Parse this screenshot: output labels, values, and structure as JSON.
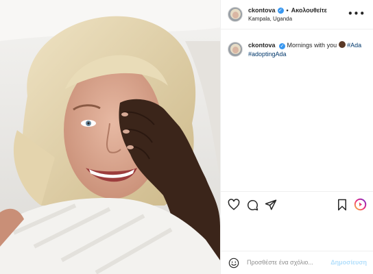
{
  "post": {
    "username": "ckontova",
    "verified_mark": "✓",
    "separator": "•",
    "follow_label": "Ακολουθείτε",
    "location": "Kampala, Uganda",
    "more_label": "•••"
  },
  "caption": {
    "username": "ckontova",
    "text": "Mornings with you",
    "emoji": "girl-emoji",
    "hashtags": [
      "#Ada",
      "#adoptingAda"
    ]
  },
  "actions": {
    "icons": [
      "heart-icon",
      "comment-icon",
      "share-icon",
      "bookmark-icon",
      "igtv-icon"
    ]
  },
  "composer": {
    "placeholder": "Προσθέστε ένα σχόλιο...",
    "post_label": "Δημοσίευση"
  },
  "colors": {
    "link": "#00376b",
    "verified": "#3897f0",
    "post_button": "#b2dffc",
    "border": "#efefef"
  }
}
